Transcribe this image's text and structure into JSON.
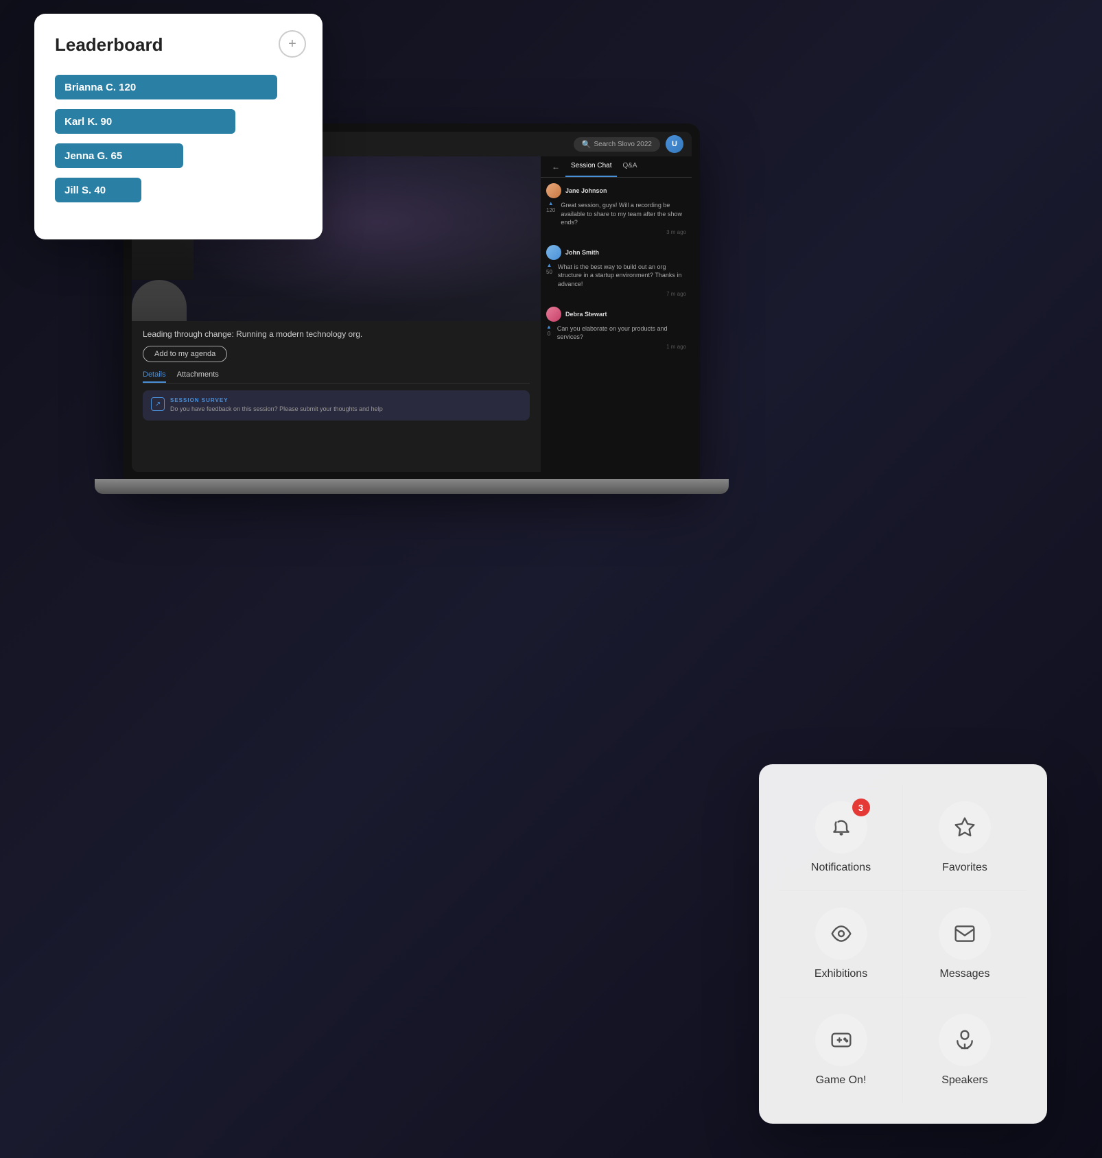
{
  "leaderboard": {
    "title": "Leaderboard",
    "plus_label": "+",
    "entries": [
      {
        "name": "Brianna C. 120",
        "width": "90%"
      },
      {
        "name": "Karl K. 90",
        "width": "73%"
      },
      {
        "name": "Jenna G. 65",
        "width": "52%"
      },
      {
        "name": "Jill S. 40",
        "width": "35%"
      }
    ]
  },
  "laptop": {
    "search_placeholder": "Search Slovo 2022",
    "session_description": "Leading through change: Running a modern technology org.",
    "add_agenda_label": "Add to my agenda",
    "tabs": [
      {
        "label": "Details",
        "active": true
      },
      {
        "label": "Attachments",
        "active": false
      }
    ],
    "survey": {
      "label": "SESSION SURVEY",
      "text": "Do you have feedback on this session? Please submit your thoughts and help"
    },
    "chat": {
      "back_label": "←",
      "tabs": [
        {
          "label": "Session Chat",
          "active": true
        },
        {
          "label": "Q&A",
          "active": false
        }
      ],
      "messages": [
        {
          "name": "Jane Johnson",
          "text": "Great session, guys! Will a recording be available to share to my team after the show ends?",
          "votes": 120,
          "time": "3 m ago"
        },
        {
          "name": "John Smith",
          "text": "What is the best way to build out an org structure in a startup environment? Thanks in advance!",
          "votes": 50,
          "time": "7 m ago"
        },
        {
          "name": "Debra Stewart",
          "text": "Can you elaborate on your products and services?",
          "votes": 0,
          "time": "1 m ago"
        }
      ]
    }
  },
  "mobile_menu": {
    "items": [
      {
        "id": "notifications",
        "label": "Notifications",
        "badge": "3",
        "icon": "bell"
      },
      {
        "id": "favorites",
        "label": "Favorites",
        "badge": "",
        "icon": "star"
      },
      {
        "id": "exhibitions",
        "label": "Exhibitions",
        "badge": "",
        "icon": "eye"
      },
      {
        "id": "messages",
        "label": "Messages",
        "badge": "",
        "icon": "mail"
      },
      {
        "id": "game-on",
        "label": "Game On!",
        "badge": "",
        "icon": "game"
      },
      {
        "id": "speakers",
        "label": "Speakers",
        "badge": "",
        "icon": "speaker"
      }
    ]
  }
}
